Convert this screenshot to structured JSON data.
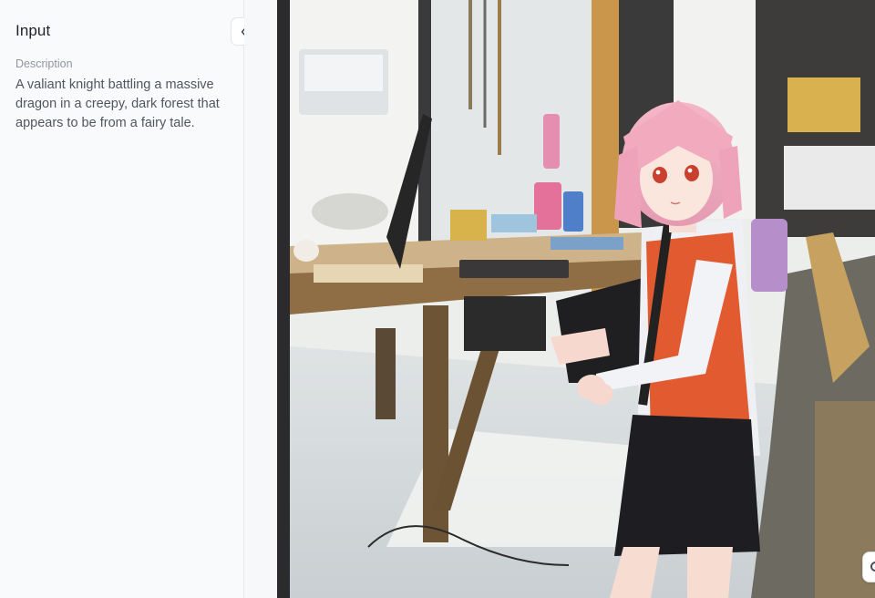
{
  "panel": {
    "title": "Input",
    "collapse_icon": "double-chevron-left-icon",
    "fields": [
      {
        "label": "Description",
        "value": "A valiant knight battling a massive dragon in a creepy, dark forest that appears to be from a fairy tale."
      }
    ]
  },
  "image": {
    "subject": "anime girl with pink hair in a cluttered workshop"
  },
  "corner_action": {
    "icon": "circle-icon"
  },
  "colors": {
    "panel_bg": "#f9fafc",
    "title": "#1f2329",
    "label": "#8f959e",
    "text": "#51565d",
    "border": "#e6e8ec"
  }
}
